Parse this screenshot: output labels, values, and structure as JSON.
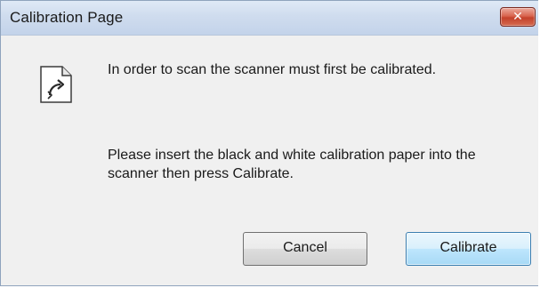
{
  "window": {
    "title": "Calibration Page",
    "close_label": "✕"
  },
  "icon": {
    "name": "document-arrow-icon"
  },
  "message": {
    "line1": "In order to scan the scanner must first be calibrated.",
    "line2": "Please insert the black and white calibration paper into the scanner then press Calibrate."
  },
  "buttons": {
    "cancel_label": "Cancel",
    "calibrate_label": "Calibrate"
  },
  "colors": {
    "close_button": "#c4412b",
    "default_button_border": "#3c7fb1",
    "dialog_background": "#f0f0f0"
  }
}
